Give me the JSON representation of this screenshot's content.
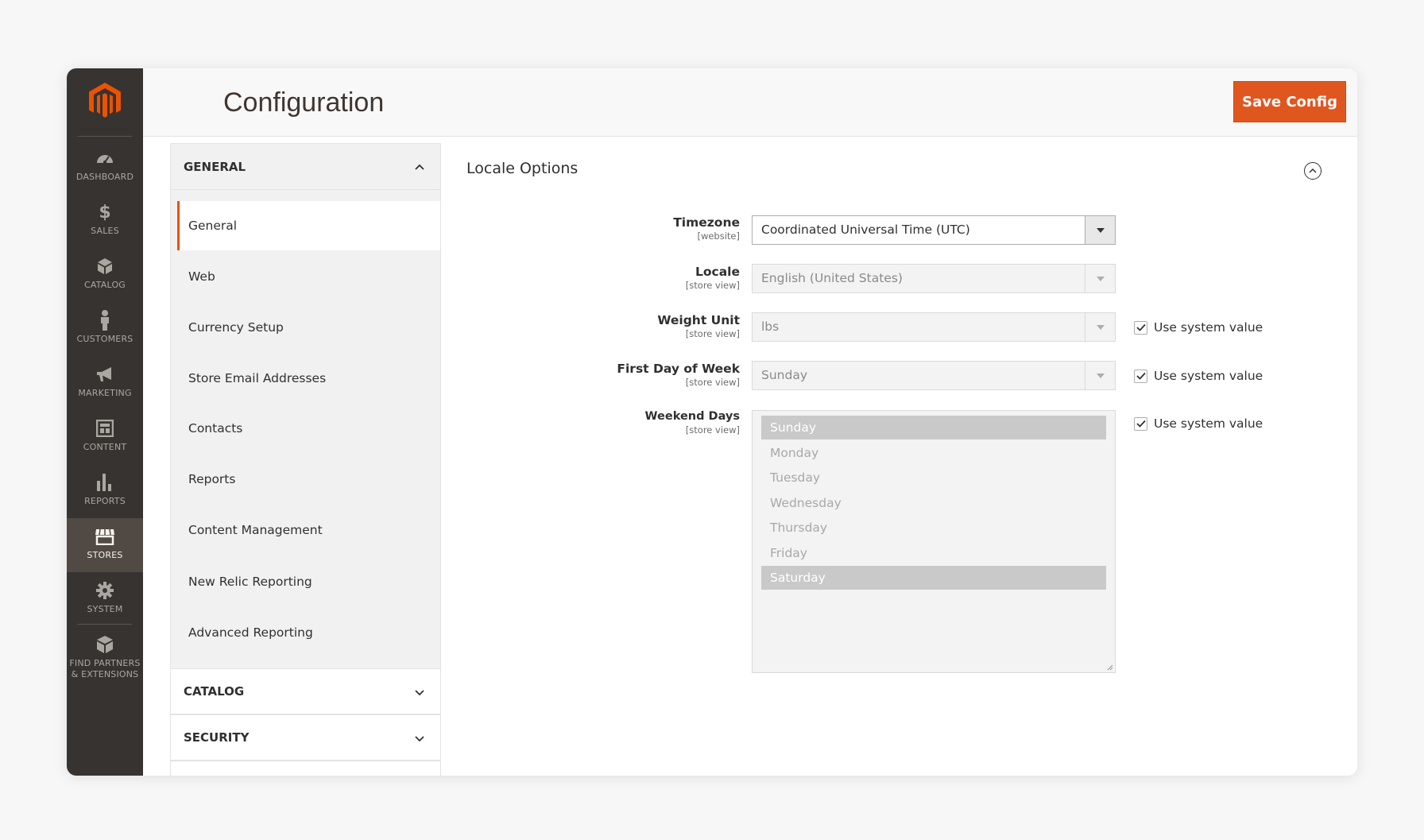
{
  "nav": {
    "items": [
      {
        "label": "DASHBOARD",
        "icon": "dashboard-icon"
      },
      {
        "label": "SALES",
        "icon": "dollar-icon"
      },
      {
        "label": "CATALOG",
        "icon": "cube-icon"
      },
      {
        "label": "CUSTOMERS",
        "icon": "person-icon"
      },
      {
        "label": "MARKETING",
        "icon": "megaphone-icon"
      },
      {
        "label": "CONTENT",
        "icon": "layout-icon"
      },
      {
        "label": "REPORTS",
        "icon": "bar-chart-icon"
      },
      {
        "label": "STORES",
        "icon": "storefront-icon"
      },
      {
        "label": "SYSTEM",
        "icon": "gear-icon"
      }
    ],
    "partners_line1": "FIND PARTNERS",
    "partners_line2": "& EXTENSIONS"
  },
  "header": {
    "title": "Configuration",
    "save_label": "Save Config"
  },
  "tabs": {
    "general_head": "GENERAL",
    "items": [
      "General",
      "Web",
      "Currency Setup",
      "Store Email Addresses",
      "Contacts",
      "Reports",
      "Content Management",
      "New Relic Reporting",
      "Advanced Reporting"
    ],
    "catalog_head": "CATALOG",
    "security_head": "SECURITY"
  },
  "section": {
    "title": "Locale Options"
  },
  "fields": {
    "timezone": {
      "label": "Timezone",
      "scope": "[website]",
      "value": "Coordinated Universal Time (UTC)"
    },
    "locale": {
      "label": "Locale",
      "scope": "[store view]",
      "value": "English (United States)"
    },
    "weight_unit": {
      "label": "Weight Unit",
      "scope": "[store view]",
      "value": "lbs",
      "system_value": "Use system value"
    },
    "first_day": {
      "label": "First Day of Week",
      "scope": "[store view]",
      "value": "Sunday",
      "system_value": "Use system value"
    },
    "weekend_days": {
      "label": "Weekend Days",
      "scope": "[store view]",
      "system_value": "Use system value",
      "options": [
        "Sunday",
        "Monday",
        "Tuesday",
        "Wednesday",
        "Thursday",
        "Friday",
        "Saturday"
      ],
      "selected": [
        "Sunday",
        "Saturday"
      ]
    }
  },
  "colors": {
    "accent": "#eb5202",
    "button": "#e0561f",
    "nav_bg": "#373330",
    "nav_active": "#514943"
  }
}
